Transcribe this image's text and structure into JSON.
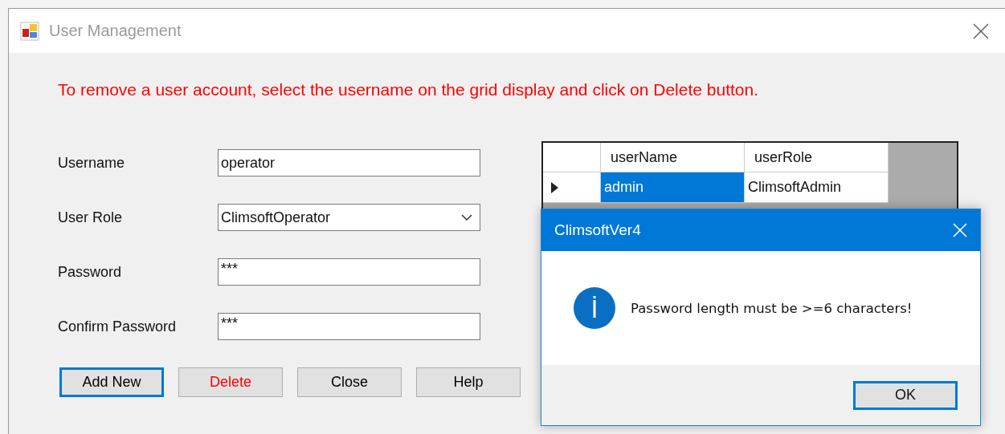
{
  "window": {
    "title": "User Management"
  },
  "instruction": "To remove a user account, select the username on the grid display and click on Delete button.",
  "form": {
    "fields": [
      {
        "label": "Username",
        "kind": "text",
        "value": "operator"
      },
      {
        "label": "User Role",
        "kind": "dropdown",
        "value": "ClimsoftOperator"
      },
      {
        "label": "Password",
        "kind": "password",
        "value": "***"
      },
      {
        "label": "Confirm Password",
        "kind": "password",
        "value": "***"
      }
    ]
  },
  "buttons": [
    {
      "label": "Add New",
      "focused": true,
      "color": "#000000"
    },
    {
      "label": "Delete",
      "focused": false,
      "color": "#ff0000"
    },
    {
      "label": "Close",
      "focused": false,
      "color": "#000000"
    },
    {
      "label": "Help",
      "focused": false,
      "color": "#000000"
    }
  ],
  "grid": {
    "columns": [
      "userName",
      "userRole"
    ],
    "rows": [
      {
        "current": true,
        "cells": [
          {
            "text": "admin",
            "selected": true
          },
          {
            "text": "ClimsoftAdmin",
            "selected": false
          }
        ]
      }
    ]
  },
  "dialog": {
    "title": "ClimsoftVer4",
    "kind": "information",
    "message": "Password length must be >=6 characters!",
    "button": {
      "label": "OK",
      "focused": true
    }
  }
}
